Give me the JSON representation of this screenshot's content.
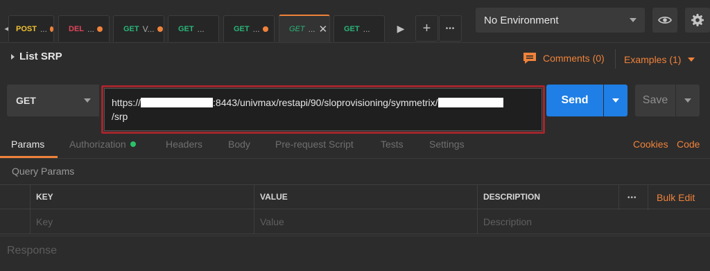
{
  "tabs": [
    {
      "method": "POST",
      "method_color": "#f1c232",
      "name": "...",
      "unsaved": true
    },
    {
      "method": "DEL",
      "method_color": "#e0455a",
      "name": "...",
      "unsaved": true
    },
    {
      "method": "GET",
      "method_color": "#29b478",
      "name": "V...",
      "unsaved": true
    },
    {
      "method": "GET",
      "method_color": "#29b478",
      "name": "...",
      "unsaved": false
    },
    {
      "method": "GET",
      "method_color": "#29b478",
      "name": "...",
      "unsaved": true
    },
    {
      "method": "GET",
      "method_color": "#29b478",
      "name": "...",
      "unsaved": false,
      "active": true
    },
    {
      "method": "GET",
      "method_color": "#29b478",
      "name": "...",
      "unsaved": false
    }
  ],
  "tab_close_glyph": "✕",
  "tab_add_glyph": "+",
  "tab_more_glyph": "•••",
  "environment": {
    "selected": "No Environment"
  },
  "request": {
    "title": "List SRP",
    "comments_label": "Comments (0)",
    "examples_label": "Examples (1)",
    "method": "GET",
    "url_prefix": "https://",
    "url_middle": ":8443/univmax/restapi/90/sloprovisioning/symmetrix/",
    "url_suffix": "/srp",
    "send_label": "Send",
    "save_label": "Save"
  },
  "subtabs": [
    "Params",
    "Authorization",
    "Headers",
    "Body",
    "Pre-request Script",
    "Tests",
    "Settings"
  ],
  "subtabs_right": [
    "Cookies",
    "Code"
  ],
  "query_params": {
    "title": "Query Params",
    "columns": [
      "KEY",
      "VALUE",
      "DESCRIPTION"
    ],
    "placeholders": [
      "Key",
      "Value",
      "Description"
    ],
    "bulk_edit_label": "Bulk Edit",
    "more_glyph": "•••"
  },
  "response_label": "Response",
  "colors": {
    "accent": "#f0823a",
    "send": "#1f7fe6",
    "highlight_border": "#a3262c",
    "auth_dot": "#29c16a"
  }
}
